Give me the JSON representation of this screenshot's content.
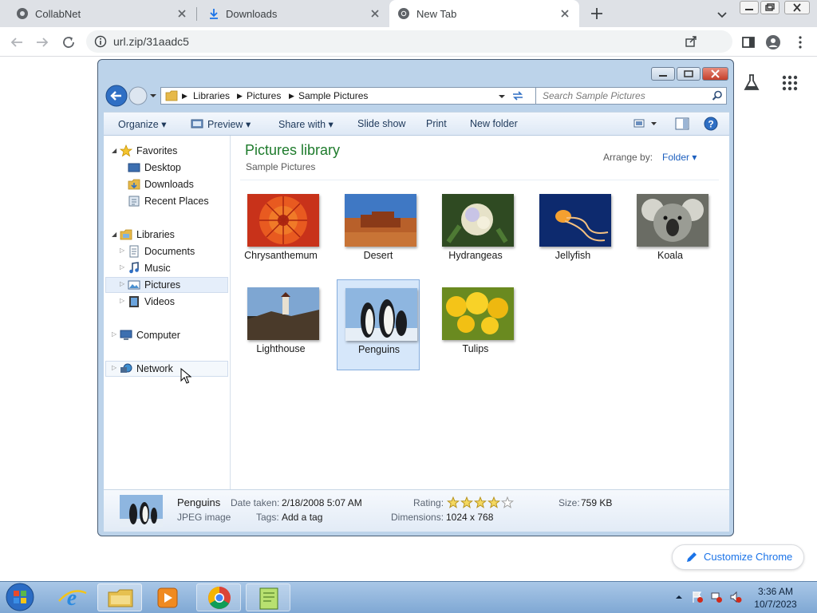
{
  "browser": {
    "tabs": [
      {
        "label": "CollabNet",
        "icon": "collabnet-favicon-icon"
      },
      {
        "label": "Downloads",
        "icon": "download-icon"
      },
      {
        "label": "New Tab",
        "icon": "chrome-icon",
        "active": true
      }
    ],
    "url": "url.zip/31aadc5",
    "customize_label": "Customize Chrome"
  },
  "explorer": {
    "breadcrumb": [
      "Libraries",
      "Pictures",
      "Sample Pictures"
    ],
    "search_placeholder": "Search Sample Pictures",
    "commands": {
      "organize": "Organize",
      "preview": "Preview",
      "share_with": "Share with",
      "slide_show": "Slide show",
      "print": "Print",
      "new_folder": "New folder"
    },
    "nav": {
      "favorites": "Favorites",
      "desktop": "Desktop",
      "downloads": "Downloads",
      "recent_places": "Recent Places",
      "libraries": "Libraries",
      "documents": "Documents",
      "music": "Music",
      "pictures": "Pictures",
      "videos": "Videos",
      "computer": "Computer",
      "network": "Network"
    },
    "library_title": "Pictures library",
    "library_subtitle": "Sample Pictures",
    "arrange_label": "Arrange by:",
    "arrange_value": "Folder",
    "thumbnails": [
      {
        "name": "Chrysanthemum"
      },
      {
        "name": "Desert"
      },
      {
        "name": "Hydrangeas"
      },
      {
        "name": "Jellyfish"
      },
      {
        "name": "Koala"
      },
      {
        "name": "Lighthouse"
      },
      {
        "name": "Penguins",
        "selected": true
      },
      {
        "name": "Tulips"
      }
    ],
    "details": {
      "name": "Penguins",
      "type": "JPEG image",
      "date_taken_label": "Date taken:",
      "date_taken": "2/18/2008 5:07 AM",
      "tags_label": "Tags:",
      "tags": "Add a tag",
      "rating_label": "Rating:",
      "rating": 4,
      "rating_max": 5,
      "dimensions_label": "Dimensions:",
      "dimensions": "1024 x 768",
      "size_label": "Size:",
      "size": "759 KB"
    }
  },
  "taskbar": {
    "time": "3:36 AM",
    "date": "10/7/2023"
  },
  "colors": {
    "accent": "#1a73e8",
    "library_green": "#1e7b2c",
    "selection": "#d6e7fa"
  }
}
